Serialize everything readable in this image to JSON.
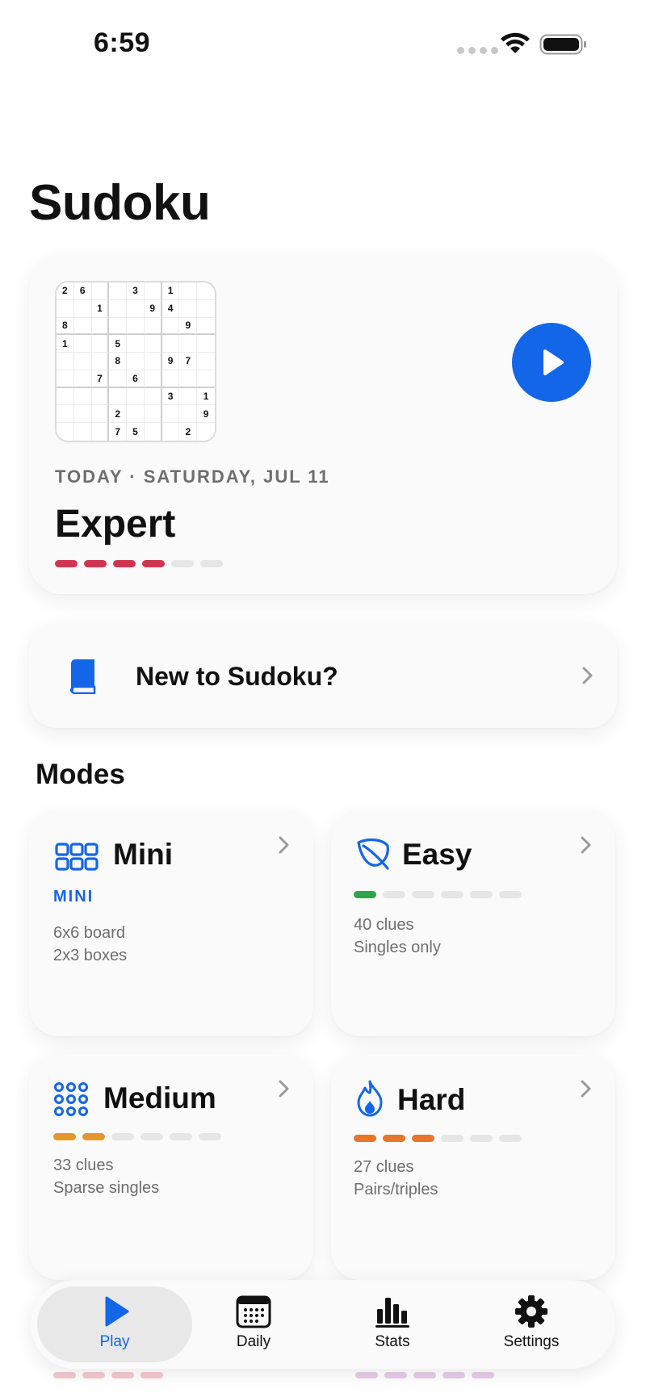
{
  "status_bar": {
    "time": "6:59"
  },
  "page_title": "Sudoku",
  "daily": {
    "board": [
      [
        "2",
        "6",
        "",
        "",
        "3",
        "",
        "1",
        "",
        ""
      ],
      [
        "",
        "",
        "1",
        "",
        "",
        "9",
        "4",
        "",
        ""
      ],
      [
        "8",
        "",
        "",
        "",
        "",
        "",
        "",
        "9",
        ""
      ],
      [
        "1",
        "",
        "",
        "5",
        "",
        "",
        "",
        "",
        ""
      ],
      [
        "",
        "",
        "",
        "8",
        "",
        "",
        "9",
        "7",
        ""
      ],
      [
        "",
        "",
        "7",
        "",
        "6",
        "",
        "",
        "",
        ""
      ],
      [
        "",
        "",
        "",
        "",
        "",
        "",
        "3",
        "",
        "1"
      ],
      [
        "",
        "",
        "",
        "2",
        "",
        "",
        "",
        "",
        "9"
      ],
      [
        "",
        "",
        "",
        "7",
        "5",
        "",
        "",
        "2",
        ""
      ]
    ],
    "date_label": "TODAY · SATURDAY, JUL 11",
    "level": "Expert",
    "difficulty": 4,
    "difficulty_max": 6,
    "difficulty_color": "#d0344e"
  },
  "tutorial": {
    "label": "New to Sudoku?"
  },
  "modes_title": "Modes",
  "modes": [
    {
      "title": "Mini",
      "tag": "MINI",
      "line1": "6x6 board",
      "line2": "2x3 boxes",
      "icon": "grid-icon"
    },
    {
      "title": "Easy",
      "line1": "40 clues",
      "line2": "Singles only",
      "difficulty": 1,
      "color": "#2fa44f",
      "icon": "leaf-icon"
    },
    {
      "title": "Medium",
      "line1": "33 clues",
      "line2": "Sparse singles",
      "difficulty": 2,
      "color": "#e0992a",
      "icon": "dots-grid-icon"
    },
    {
      "title": "Hard",
      "line1": "27 clues",
      "line2": "Pairs/triples",
      "difficulty": 3,
      "color": "#e8762a",
      "icon": "flame-icon"
    }
  ],
  "tabs": [
    {
      "label": "Play",
      "icon": "play-icon",
      "active": true
    },
    {
      "label": "Daily",
      "icon": "calendar-icon"
    },
    {
      "label": "Stats",
      "icon": "bar-chart-icon"
    },
    {
      "label": "Settings",
      "icon": "gear-icon"
    }
  ],
  "colors": {
    "accent": "#1466e8",
    "background": "#ffffff",
    "card": "#fafafa"
  }
}
